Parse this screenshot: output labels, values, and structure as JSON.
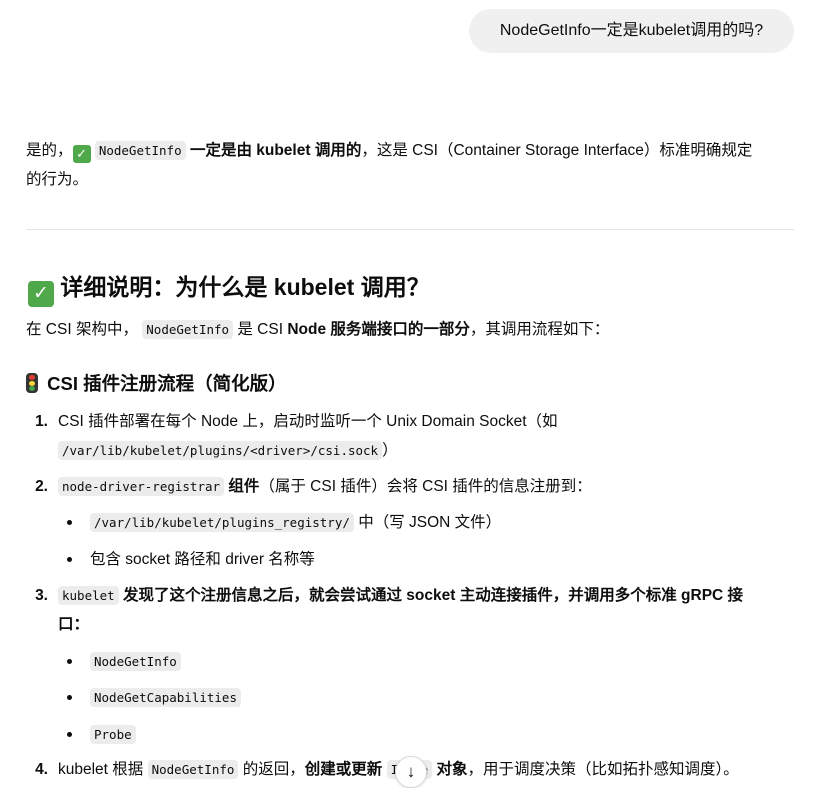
{
  "user_message": "NodeGetInfo一定是kubelet调用的吗?",
  "answer": {
    "p1": {
      "t1": "是的，",
      "code1": "NodeGetInfo",
      "b1": "一定是由 kubelet 调用的",
      "t2": "，这是 CSI（Container Storage Interface）标准明确规定",
      "t3": "的行为。"
    },
    "h2": "详细说明：为什么是 kubelet 调用？",
    "p2": {
      "t1": "在 CSI 架构中，",
      "code1": "NodeGetInfo",
      "t2": "是 CSI",
      "b1": "Node 服务端接口的一部分",
      "t3": "，其调用流程如下："
    },
    "h3": "CSI 插件注册流程（简化版）",
    "steps": [
      {
        "num": "1.",
        "t1": "CSI 插件部署在每个 Node 上，启动时监听一个 Unix Domain Socket（如",
        "code1": "/var/lib/kubelet/plugins/<driver>/csi.sock",
        "t2": "）"
      },
      {
        "num": "2.",
        "code1": "node-driver-registrar",
        "b1": "组件",
        "t1": "（属于 CSI 插件）会将 CSI 插件的信息注册到：",
        "bullets": [
          {
            "code": "/var/lib/kubelet/plugins_registry/",
            "text": "中（写 JSON 文件）"
          },
          {
            "text": "包含 socket 路径和 driver 名称等"
          }
        ]
      },
      {
        "num": "3.",
        "code1": "kubelet",
        "b1": "发现了这个注册信息之后，就会尝试通过 socket 主动连接插件，并调用多个标准 gRPC 接",
        "b2": "口：",
        "bullets": [
          "NodeGetInfo",
          "NodeGetCapabilities",
          "Probe"
        ]
      },
      {
        "num": "4.",
        "t1": "kubelet 根据",
        "code1": "NodeGetInfo",
        "t2": "的返回，",
        "b1": "创建或更新",
        "code2": "INode",
        "b2": "对象",
        "t3": "，用于调度决策（比如拓扑感知调度）。"
      }
    ]
  },
  "icons": {
    "check": "✓",
    "scroll_down": "↓"
  },
  "colors": {
    "check_green": "#4fa84a",
    "code_bg": "#ececec",
    "user_bubble_bg": "#f0f0f0"
  }
}
